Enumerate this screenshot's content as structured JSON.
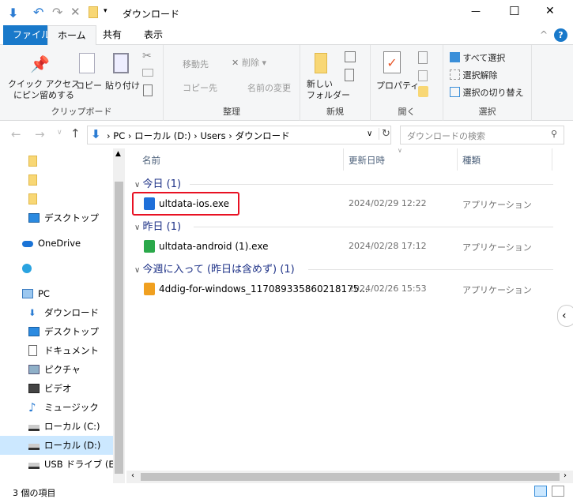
{
  "window": {
    "title": "ダウンロード",
    "minimize": "—",
    "maximize": "☐",
    "close": "✕"
  },
  "tabs": [
    {
      "label": "ファイル"
    },
    {
      "label": "ホーム"
    },
    {
      "label": "共有"
    },
    {
      "label": "表示"
    }
  ],
  "ribbon": {
    "clipboard": {
      "label": "クリップボード",
      "pin": "クイック アクセス",
      "pin2": "にピン留めする",
      "copy": "コピー",
      "paste": "貼り付け"
    },
    "organize": {
      "label": "整理",
      "move": "移動先",
      "copyto": "コピー先",
      "delete": "削除",
      "rename": "名前の変更"
    },
    "new": {
      "label": "新規",
      "folder": "新しい",
      "folder2": "フォルダー"
    },
    "open": {
      "label": "開く",
      "properties": "プロパティ"
    },
    "select": {
      "label": "選択",
      "all": "すべて選択",
      "none": "選択解除",
      "invert": "選択の切り替え"
    }
  },
  "address": {
    "crumbs": [
      "PC",
      "ローカル (D:)",
      "Users",
      "ダウンロード"
    ],
    "search_placeholder": "ダウンロードの検索"
  },
  "sidebar": {
    "items": [
      {
        "label": "",
        "icon": "folder-icon"
      },
      {
        "label": "",
        "icon": "folder-icon"
      },
      {
        "label": "",
        "icon": "folder-icon"
      },
      {
        "label": "デスクトップ",
        "icon": "desktop-icon"
      },
      {
        "label": "OneDrive",
        "icon": "onedrive-icon"
      },
      {
        "label": "",
        "icon": "cloud-icon"
      },
      {
        "label": "PC",
        "icon": "pc-icon"
      },
      {
        "label": "ダウンロード",
        "icon": "download-icon"
      },
      {
        "label": "デスクトップ",
        "icon": "desktop-icon"
      },
      {
        "label": "ドキュメント",
        "icon": "document-icon"
      },
      {
        "label": "ピクチャ",
        "icon": "picture-icon"
      },
      {
        "label": "ビデオ",
        "icon": "video-icon"
      },
      {
        "label": "ミュージック",
        "icon": "music-icon"
      },
      {
        "label": "ローカル (C:)",
        "icon": "drive-icon"
      },
      {
        "label": "ローカル (D:)",
        "icon": "drive-icon",
        "selected": true
      },
      {
        "label": "USB ドライブ (E:)",
        "icon": "usb-drive-icon"
      }
    ]
  },
  "columns": {
    "name": "名前",
    "date": "更新日時",
    "type": "種類"
  },
  "groups": [
    {
      "label": "今日 (1)",
      "files": [
        {
          "name": "ultdata-ios.exe",
          "date": "2024/02/29 12:22",
          "type": "アプリケーション",
          "highlighted": true,
          "color": "#1e6fd9"
        }
      ]
    },
    {
      "label": "昨日 (1)",
      "files": [
        {
          "name": "ultdata-android (1).exe",
          "date": "2024/02/28 17:12",
          "type": "アプリケーション",
          "color": "#2aa84a"
        }
      ]
    },
    {
      "label": "今週に入って (昨日は含めず) (1)",
      "files": [
        {
          "name": "4ddig-for-windows_117089335860218175...",
          "date": "2024/02/26 15:53",
          "type": "アプリケーション",
          "color": "#f0a020"
        }
      ]
    }
  ],
  "status": {
    "count": "3 個の項目"
  },
  "colors": {
    "accent": "#1979ca",
    "highlight": "#e81123",
    "selected": "#cce8ff"
  }
}
